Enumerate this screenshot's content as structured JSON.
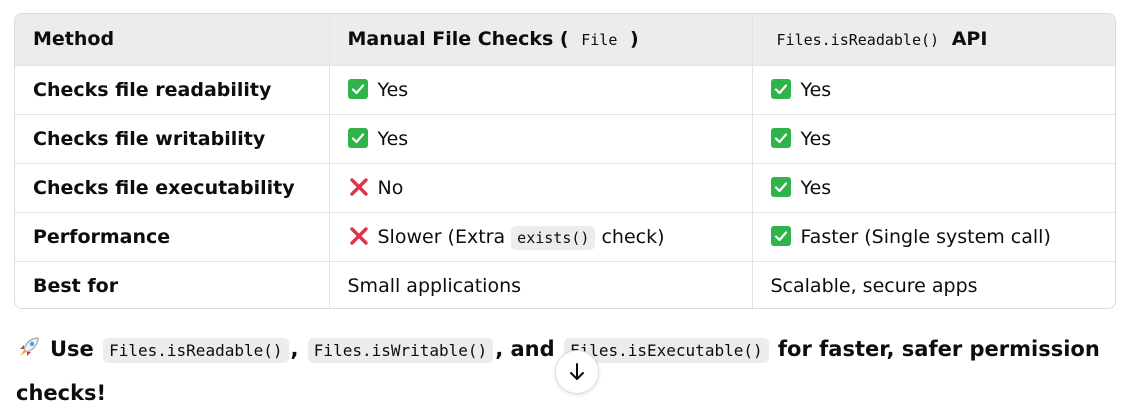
{
  "table": {
    "headers": {
      "method": "Method",
      "manual_prefix": "Manual File Checks (",
      "manual_code": "File",
      "manual_suffix": ")",
      "api_code": "Files.isReadable()",
      "api_suffix": "API"
    },
    "rows": [
      {
        "label": "Checks file readability",
        "manual": {
          "icon": "check-icon",
          "text": "Yes"
        },
        "api": {
          "icon": "check-icon",
          "text": "Yes"
        }
      },
      {
        "label": "Checks file writability",
        "manual": {
          "icon": "check-icon",
          "text": "Yes"
        },
        "api": {
          "icon": "check-icon",
          "text": "Yes"
        }
      },
      {
        "label": "Checks file executability",
        "manual": {
          "icon": "cross-icon",
          "text": "No"
        },
        "api": {
          "icon": "check-icon",
          "text": "Yes"
        }
      },
      {
        "label": "Performance",
        "manual": {
          "icon": "cross-icon",
          "text_before": "Slower (Extra",
          "code": "exists()",
          "text_after": "check)"
        },
        "api": {
          "icon": "check-icon",
          "text": "Faster (Single system call)"
        }
      },
      {
        "label": "Best for",
        "manual": {
          "text": "Small applications"
        },
        "api": {
          "text": "Scalable, secure apps"
        }
      }
    ]
  },
  "footer": {
    "icon": "rocket-icon",
    "lead": "Use",
    "code1": "Files.isReadable()",
    "sep1": ",",
    "code2": "Files.isWritable()",
    "sep2": ", and",
    "code3": "Files.isExecutable()",
    "tail": "for faster, safer permission checks!"
  },
  "colors": {
    "check_green": "#2fb34a",
    "cross_red": "#e0324b",
    "header_bg": "#ececec"
  },
  "scroll_button": {
    "icon": "arrow-down-icon"
  }
}
